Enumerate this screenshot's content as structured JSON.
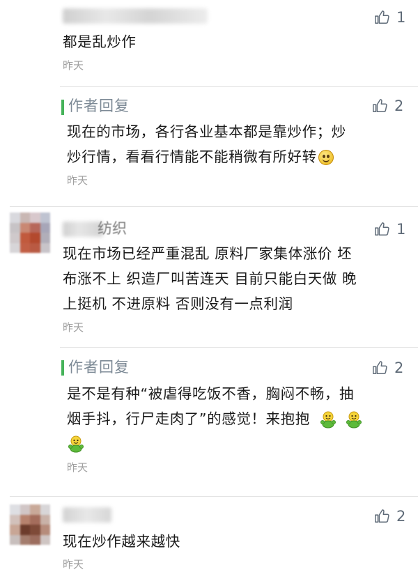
{
  "comments": [
    {
      "name_suffix": "",
      "likes": "1",
      "text": [
        "都是乱炒作"
      ],
      "time": "昨天",
      "reply": {
        "label": "作者回复",
        "likes": "2",
        "text": [
          "现在的市场，各行各业基本都是靠炒作；炒",
          "炒行情，看看行情能不能稍微有所好转"
        ],
        "time": "昨天"
      }
    },
    {
      "name_suffix": "纺织",
      "likes": "1",
      "text": [
        "现在市场已经严重混乱 原料厂家集体涨价 坯",
        "布涨不上 织造厂叫苦连天 目前只能白天做 晚",
        "上挺机 不进原料 否则没有一点利润"
      ],
      "time": "昨天",
      "reply": {
        "label": "作者回复",
        "likes": "2",
        "text": [
          "是不是有种“被虐得吃饭不香，胸闷不畅，抽",
          "烟手抖，行尸走肉了”的感觉！来抱抱"
        ],
        "time": "昨天"
      }
    },
    {
      "name_suffix": "",
      "likes": "2",
      "text": [
        "现在炒作越来越快"
      ],
      "time": "昨天"
    }
  ],
  "icons": {
    "like": "thumbs-up-icon",
    "smile": "smile-emoji",
    "hug": "hug-emoji"
  },
  "colors": {
    "reply_bar": "#46b35a",
    "like_icon": "#5f6b78",
    "reply_label": "#7d8a96",
    "time": "#a0a0a0"
  }
}
